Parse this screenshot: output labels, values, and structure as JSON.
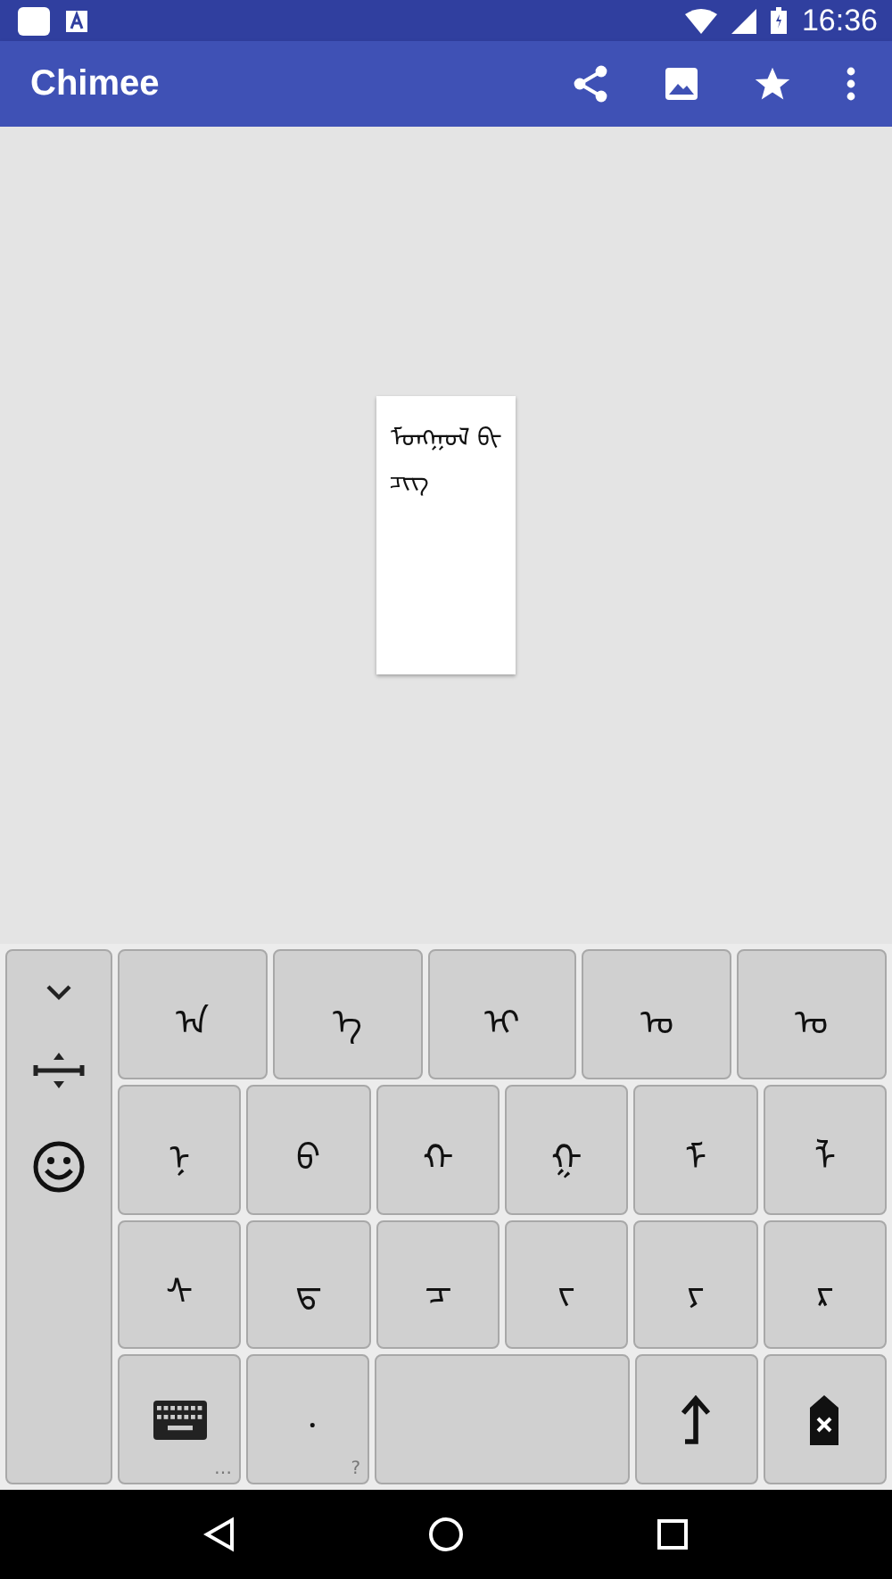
{
  "status_bar": {
    "time": "16:36"
  },
  "app_bar": {
    "title": "Chimee"
  },
  "editor": {
    "text": "ᠮᠣᠩᠭᠣᠯ ᠪᠢᠴᠢᠭ"
  },
  "keyboard": {
    "rows": [
      [
        {
          "kind": "letter",
          "label": "ᠠ"
        },
        {
          "kind": "letter",
          "label": "ᠡ"
        },
        {
          "kind": "letter",
          "label": "ᠢ"
        },
        {
          "kind": "letter",
          "label": "ᠣ"
        },
        {
          "kind": "letter",
          "label": "ᠤ"
        }
      ],
      [
        {
          "kind": "letter",
          "label": "ᠨ"
        },
        {
          "kind": "letter",
          "label": "ᠪ"
        },
        {
          "kind": "letter",
          "label": "ᠬ"
        },
        {
          "kind": "letter",
          "label": "ᠭ"
        },
        {
          "kind": "letter",
          "label": "ᠮ"
        },
        {
          "kind": "letter",
          "label": "ᠯ"
        }
      ],
      [
        {
          "kind": "letter",
          "label": "ᠰ"
        },
        {
          "kind": "letter",
          "label": "ᠳ"
        },
        {
          "kind": "letter",
          "label": "ᠴ"
        },
        {
          "kind": "letter",
          "label": "ᠵ"
        },
        {
          "kind": "letter",
          "label": "ᠶ"
        },
        {
          "kind": "letter",
          "label": "ᠷ"
        }
      ],
      [
        {
          "kind": "keyboard",
          "hint": "…"
        },
        {
          "kind": "punct",
          "label": "᠂",
          "hint": "?"
        },
        {
          "kind": "space"
        },
        {
          "kind": "enter"
        },
        {
          "kind": "backspace"
        }
      ]
    ]
  }
}
